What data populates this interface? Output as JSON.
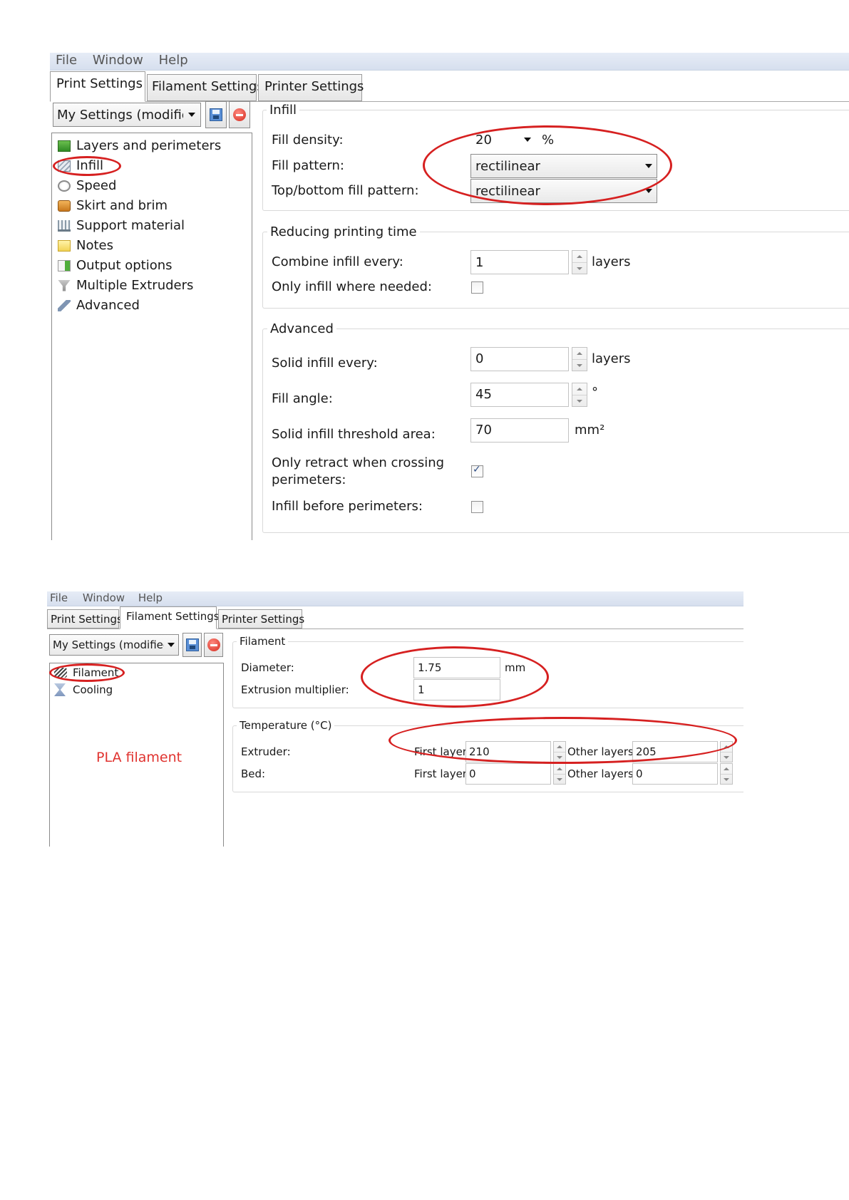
{
  "colors": {
    "annotation": "#d62020",
    "note": "#e0332f",
    "menubar": "#dbe3f0"
  },
  "shot1": {
    "menu": [
      "File",
      "Window",
      "Help"
    ],
    "tabs": [
      "Print Settings",
      "Filament Settings",
      "Printer Settings"
    ],
    "active_tab": "Print Settings",
    "preset": "My Settings (modified",
    "tree": [
      {
        "label": "Layers and perimeters",
        "icon": "layers-icon"
      },
      {
        "label": "Infill",
        "icon": "infill-icon"
      },
      {
        "label": "Speed",
        "icon": "speed-icon"
      },
      {
        "label": "Skirt and brim",
        "icon": "skirt-icon"
      },
      {
        "label": "Support material",
        "icon": "support-icon"
      },
      {
        "label": "Notes",
        "icon": "notes-icon"
      },
      {
        "label": "Output options",
        "icon": "output-icon"
      },
      {
        "label": "Multiple Extruders",
        "icon": "funnel-icon"
      },
      {
        "label": "Advanced",
        "icon": "wrench-icon"
      }
    ],
    "infill": {
      "title": "Infill",
      "fill_density_label": "Fill density:",
      "fill_density_value": "20",
      "fill_density_unit": "%",
      "fill_pattern_label": "Fill pattern:",
      "fill_pattern_value": "rectilinear",
      "top_bottom_label": "Top/bottom fill pattern:",
      "top_bottom_value": "rectilinear"
    },
    "reducing": {
      "title": "Reducing printing time",
      "combine_label": "Combine infill every:",
      "combine_value": "1",
      "combine_unit": "layers",
      "only_infill_label": "Only infill where needed:",
      "only_infill_checked": false
    },
    "advanced": {
      "title": "Advanced",
      "solid_every_label": "Solid infill every:",
      "solid_every_value": "0",
      "solid_every_unit": "layers",
      "fill_angle_label": "Fill angle:",
      "fill_angle_value": "45",
      "fill_angle_unit": "°",
      "threshold_label": "Solid infill threshold area:",
      "threshold_value": "70",
      "threshold_unit": "mm²",
      "retract_label_1": "Only retract when crossing",
      "retract_label_2": "perimeters:",
      "retract_checked": true,
      "before_label": "Infill before perimeters:",
      "before_checked": false
    }
  },
  "shot2": {
    "menu": [
      "File",
      "Window",
      "Help"
    ],
    "tabs": [
      "Print Settings",
      "Filament Settings",
      "Printer Settings"
    ],
    "active_tab": "Filament Settings",
    "preset": "My Settings (modified",
    "tree": [
      {
        "label": "Filament",
        "icon": "filament-icon"
      },
      {
        "label": "Cooling",
        "icon": "hourglass-icon"
      }
    ],
    "note": "PLA filament",
    "filament": {
      "title": "Filament",
      "diameter_label": "Diameter:",
      "diameter_value": "1.75",
      "diameter_unit": "mm",
      "extrusion_label": "Extrusion multiplier:",
      "extrusion_value": "1"
    },
    "temperature": {
      "title": "Temperature (°C)",
      "extruder_label": "Extruder:",
      "bed_label": "Bed:",
      "first_layer_label": "First layer:",
      "other_layers_label": "Other layers:",
      "extruder_first": "210",
      "extruder_other": "205",
      "bed_first": "0",
      "bed_other": "0"
    }
  }
}
